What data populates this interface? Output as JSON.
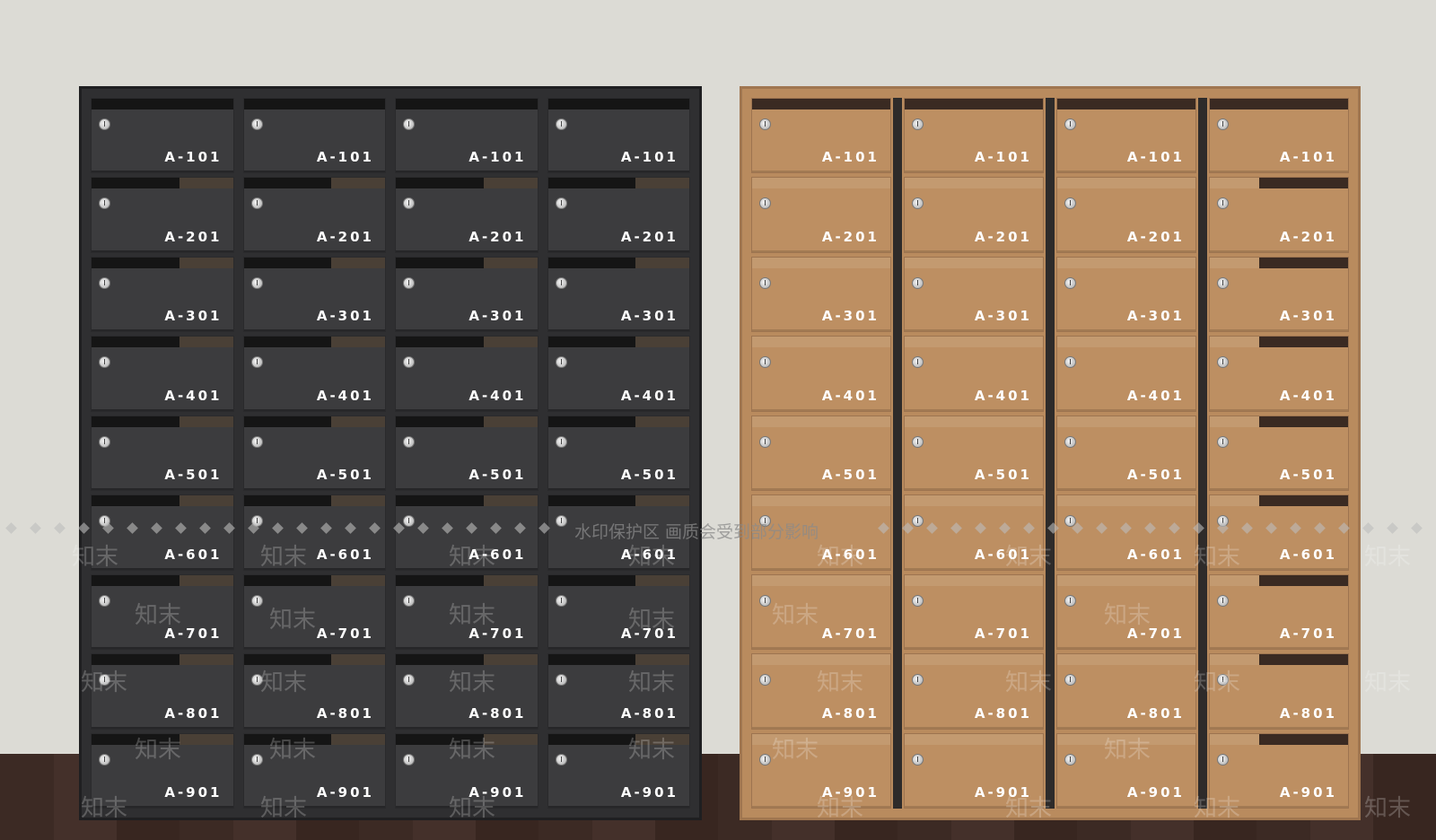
{
  "cabinets": [
    {
      "name": "dark",
      "rows": [
        [
          "A-101",
          "A-101",
          "A-101",
          "A-101"
        ],
        [
          "A-201",
          "A-201",
          "A-201",
          "A-201"
        ],
        [
          "A-301",
          "A-301",
          "A-301",
          "A-301"
        ],
        [
          "A-401",
          "A-401",
          "A-401",
          "A-401"
        ],
        [
          "A-501",
          "A-501",
          "A-501",
          "A-501"
        ],
        [
          "A-601",
          "A-601",
          "A-601",
          "A-601"
        ],
        [
          "A-701",
          "A-701",
          "A-701",
          "A-701"
        ],
        [
          "A-801",
          "A-801",
          "A-801",
          "A-801"
        ],
        [
          "A-901",
          "A-901",
          "A-901",
          "A-901"
        ]
      ]
    },
    {
      "name": "gold",
      "rows": [
        [
          "A-101",
          "A-101",
          "A-101",
          "A-101"
        ],
        [
          "A-201",
          "A-201",
          "A-201",
          "A-201"
        ],
        [
          "A-301",
          "A-301",
          "A-301",
          "A-301"
        ],
        [
          "A-401",
          "A-401",
          "A-401",
          "A-401"
        ],
        [
          "A-501",
          "A-501",
          "A-501",
          "A-501"
        ],
        [
          "A-601",
          "A-601",
          "A-601",
          "A-601"
        ],
        [
          "A-701",
          "A-701",
          "A-701",
          "A-701"
        ],
        [
          "A-801",
          "A-801",
          "A-801",
          "A-801"
        ],
        [
          "A-901",
          "A-901",
          "A-901",
          "A-901"
        ]
      ]
    }
  ],
  "watermark": {
    "text": "水印保护区   画质会受到部分影响",
    "brand": "知末"
  },
  "colors": {
    "wall": "#dcdbd5",
    "floor": "#3c2a24",
    "dark_cabinet": "#2f2f31",
    "gold_cabinet": "#b98b5e"
  }
}
